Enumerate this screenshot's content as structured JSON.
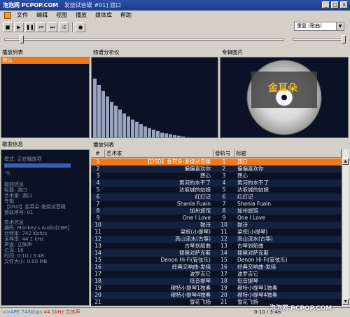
{
  "window": {
    "watermark": "泡泡网 PCPOP.COM",
    "title": "发烧试音碟 #01] 渡口"
  },
  "menu": [
    "文件",
    "编辑",
    "视图",
    "播放",
    "媒体库",
    "帮助"
  ],
  "toolbar": {
    "buttons": [
      "stop-icon",
      "play-icon",
      "pause-icon",
      "prev-icon",
      "next-icon",
      "random-icon",
      "open-icon"
    ],
    "order_select": "重复 (歌曲)"
  },
  "panels": {
    "playlist_label": "播放列表",
    "spectrum_label": "频谱分析仪",
    "album_label": "专辑图片",
    "info_label": "歌曲信息",
    "tracklist_label": "播放列表"
  },
  "playlist": {
    "items": [
      "默认"
    ]
  },
  "spectrum": [
    0.78,
    0.7,
    0.62,
    0.55,
    0.48,
    0.43,
    0.38,
    0.33,
    0.29,
    0.25,
    0.22,
    0.19,
    0.16,
    0.14,
    0.12,
    0.1,
    0.08,
    0.07,
    0.06,
    0.05,
    0.04,
    0.03,
    0.02,
    0.02,
    0.01,
    0.01,
    0.01,
    0.01
  ],
  "album_text": "金耳朵",
  "info": {
    "mode": "模式: 正在播放项",
    "rating": "·%",
    "song_header": "歌曲信息",
    "title": "标题: 渡口",
    "artist": "艺术家: 渡口",
    "album_key": "专辑",
    "album": "【DSD】金耳朵-发烧试音碟",
    "trackno": "音轨序号: 01",
    "tech_header": "技术信息",
    "codec": "编码: Monkey's Audio[CBR]",
    "bitrate": "比特率: 742 Kbit/s",
    "samplerate": "采样率: 44.1 kHz",
    "channels": "声道: 立体声",
    "bits": "位深: 16",
    "time": "时间: 0:10 / 3:48",
    "filesize": "文件大小: 0.00 MB"
  },
  "table": {
    "headers": [
      "#",
      "艺术家",
      "音轨号",
      "标题"
    ],
    "rows": [
      [
        "1",
        "【DSD】金耳朵-发烧试音碟",
        "1",
        "渡口"
      ],
      [
        "2",
        "偏偏喜欢你",
        "2",
        "偏偏喜欢你"
      ],
      [
        "3",
        "葬心",
        "3",
        "葬心"
      ],
      [
        "4",
        "黄河的水干了",
        "4",
        "黄河的水干了"
      ],
      [
        "5",
        "达坂城的姑娘",
        "5",
        "达坂城的姑娘"
      ],
      [
        "6",
        "红灯记",
        "6",
        "红灯记"
      ],
      [
        "7",
        "Shania Fuain",
        "7",
        "Shania Fuain"
      ],
      [
        "8",
        "加州旅馆",
        "8",
        "加州旅馆"
      ],
      [
        "9",
        "One I Love",
        "9",
        "One I Love"
      ],
      [
        "10",
        "鼓诗",
        "10",
        "鼓诗"
      ],
      [
        "11",
        "梁祝(小提琴)",
        "11",
        "梁祝(小提琴)"
      ],
      [
        "12",
        "高山流水(古筝)",
        "12",
        "高山流水(古筝)"
      ],
      [
        "13",
        "古琴划船曲",
        "13",
        "古琴划船曲"
      ],
      [
        "14",
        "琵琶对萨克斯",
        "14",
        "琵琶对萨克斯"
      ],
      [
        "15",
        "Denon Hi-Fi(管弦乐)",
        "15",
        "Denon Hi-Fi(管弦乐)"
      ],
      [
        "16",
        "经典交响曲-发挠",
        "16",
        "经典交响曲-发挠"
      ],
      [
        "17",
        "波罗吉它",
        "17",
        "波罗吉它"
      ],
      [
        "18",
        "低音提琴",
        "18",
        "低音提琴"
      ],
      [
        "19",
        "穆特小提琴1独奏",
        "19",
        "穆特小提琴1独奏"
      ],
      [
        "20",
        "穆特小提琴4独奏",
        "20",
        "穆特小提琴4独奏"
      ],
      [
        "21",
        "雪花飞扬",
        "21",
        "雪花飞扬"
      ]
    ]
  },
  "status": {
    "left_a": "<>APE 743kbps",
    "left_b": "44.1kHz 立体声",
    "time": "0:10 / 3:48"
  }
}
